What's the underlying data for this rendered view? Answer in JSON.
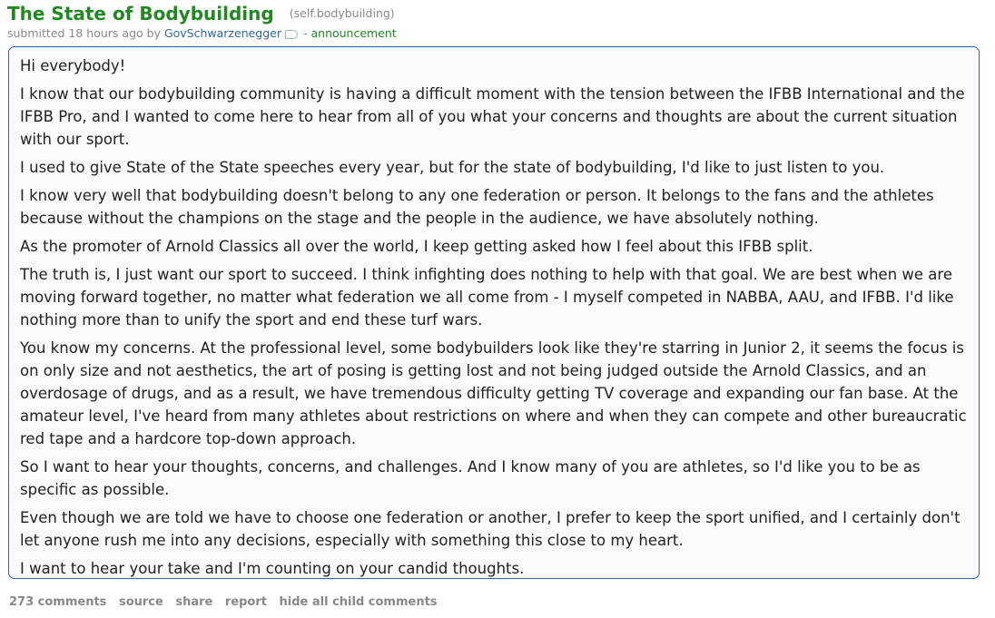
{
  "post": {
    "title": "The State of Bodybuilding",
    "domain": "(self.bodybuilding)",
    "tagline": {
      "submitted": "submitted 18 hours ago by",
      "author": "GovSchwarzenegger",
      "separator": "-",
      "flair": "announcement"
    },
    "paragraphs": [
      "Hi everybody!",
      "I know that our bodybuilding community is having a difficult moment with the tension between the IFBB International and the IFBB Pro, and I wanted to come here to hear from all of you what your concerns and thoughts are about the current situation with our sport.",
      "I used to give State of the State speeches every year, but for the state of bodybuilding, I'd like to just listen to you.",
      "I know very well that bodybuilding doesn't belong to any one federation or person. It belongs to the fans and the athletes because without the champions on the stage and the people in the audience, we have absolutely nothing.",
      "As the promoter of Arnold Classics all over the world, I keep getting asked how I feel about this IFBB split.",
      "The truth is, I just want our sport to succeed. I think infighting does nothing to help with that goal. We are best when we are moving forward together, no matter what federation we all come from - I myself competed in NABBA, AAU, and IFBB. I'd like nothing more than to unify the sport and end these turf wars.",
      "You know my concerns. At the professional level, some bodybuilders look like they're starring in Junior 2, it seems the focus is on only size and not aesthetics, the art of posing is getting lost and not being judged outside the Arnold Classics, and an overdosage of drugs, and as a result, we have tremendous difficulty getting TV coverage and expanding our fan base. At the amateur level, I've heard from many athletes about restrictions on where and when they can compete and other bureaucratic red tape and a hardcore top-down approach.",
      "So I want to hear your thoughts, concerns, and challenges. And I know many of you are athletes, so I'd like you to be as specific as possible.",
      "Even though we are told we have to choose one federation or another, I prefer to keep the sport unified, and I certainly don't let anyone rush me into any decisions, especially with something this close to my heart.",
      "I want to hear your take and I'm counting on your candid thoughts."
    ]
  },
  "actions": {
    "comments": "273 comments",
    "source": "source",
    "share": "share",
    "report": "report",
    "hide_child": "hide all child comments"
  },
  "colors": {
    "title": "#228822",
    "author": "#336699",
    "muted": "#888888",
    "box_border": "#336699"
  },
  "icons": {
    "verified_tag": "tag-icon"
  }
}
